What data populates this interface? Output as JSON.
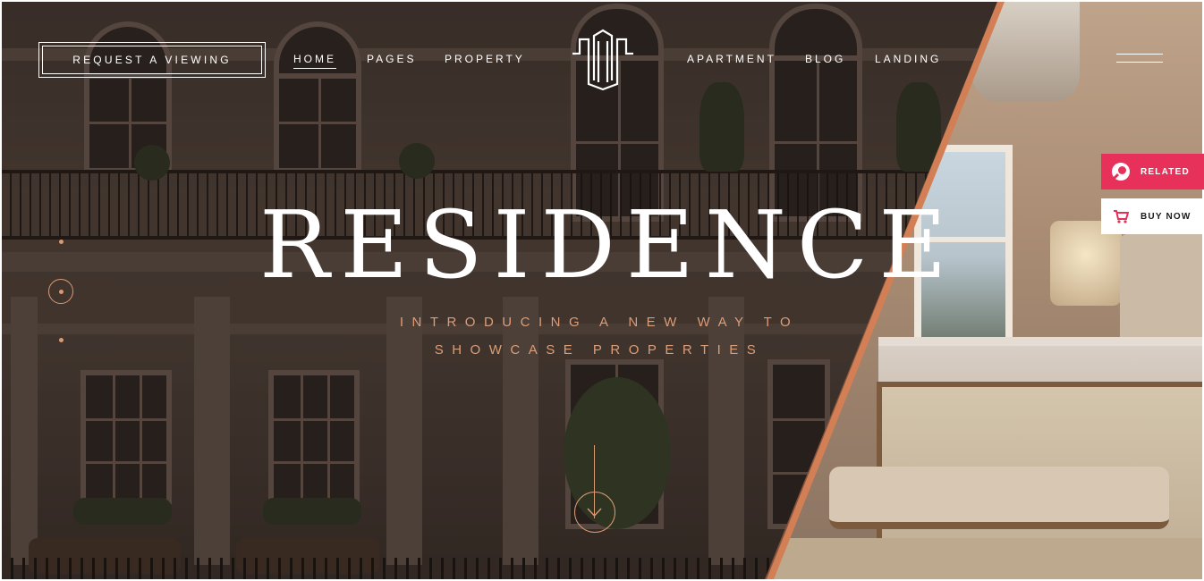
{
  "header": {
    "cta_label": "REQUEST A VIEWING",
    "nav_left": [
      {
        "label": "HOME",
        "active": true
      },
      {
        "label": "PAGES",
        "active": false
      },
      {
        "label": "PROPERTY",
        "active": false
      }
    ],
    "nav_right": [
      {
        "label": "APARTMENT",
        "active": false
      },
      {
        "label": "BLOG",
        "active": false
      },
      {
        "label": "LANDING",
        "active": false
      }
    ],
    "logo_icon": "building-logo-icon",
    "menu_icon": "hamburger-menu-icon"
  },
  "hero": {
    "title": "RESIDENCE",
    "subtitle_line1": "INTRODUCING A NEW WAY TO",
    "subtitle_line2": "SHOWCASE PROPERTIES",
    "scroll_icon": "arrow-down-icon",
    "active_slide": 2,
    "slide_count": 3
  },
  "side_buttons": {
    "related_label": "RELATED",
    "buy_label": "BUY NOW",
    "related_icon": "circle-logo-icon",
    "buy_icon": "cart-icon"
  },
  "colors": {
    "accent": "#d99a73",
    "related_bg": "#e8315a",
    "copper": "#d37f55"
  }
}
